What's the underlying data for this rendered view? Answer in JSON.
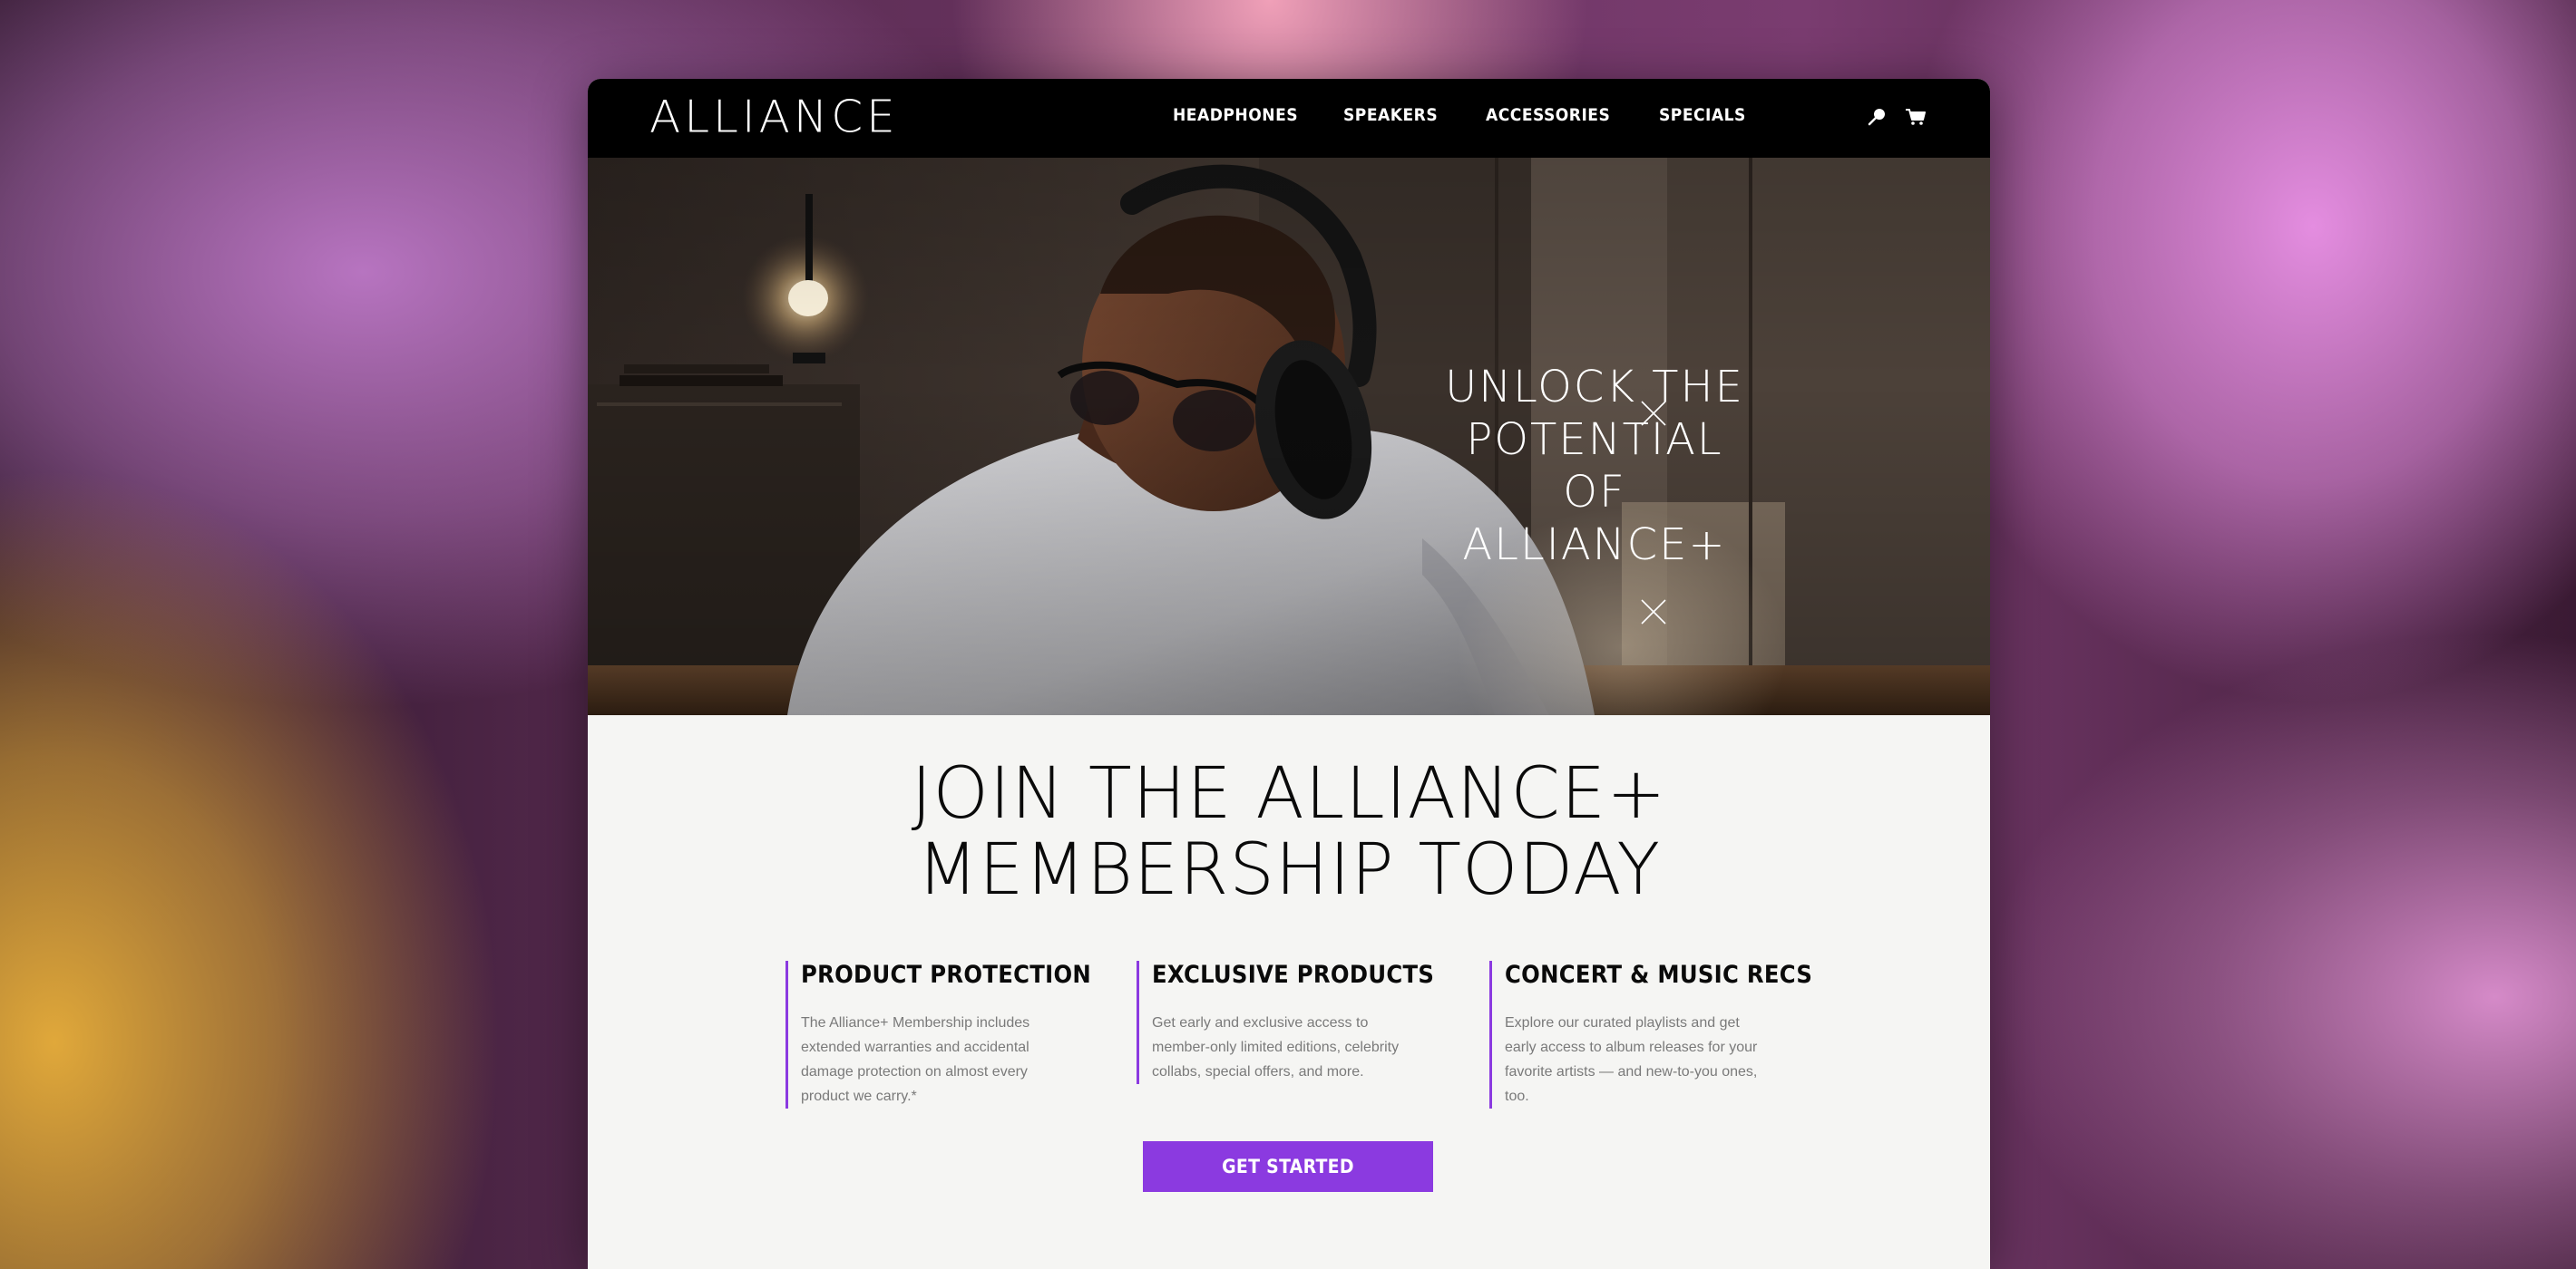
{
  "header": {
    "logo": "ALLIANCE",
    "nav": [
      {
        "label": "HEADPHONES"
      },
      {
        "label": "SPEAKERS"
      },
      {
        "label": "ACCESSORIES"
      },
      {
        "label": "SPECIALS"
      }
    ],
    "icons": [
      "search-icon",
      "cart-icon"
    ]
  },
  "hero": {
    "title_line1": "UNLOCK THE",
    "title_line2": "POTENTIAL OF",
    "title_line3": "ALLIANCE+",
    "image": "photo-man-with-headphones"
  },
  "join": {
    "line1": "JOIN THE ALLIANCE+",
    "line2": "MEMBERSHIP TODAY"
  },
  "features": [
    {
      "title": "PRODUCT PROTECTION",
      "text": "The Alliance+ Membership includes extended warranties and accidental damage protection on almost every product we carry.*"
    },
    {
      "title": "EXCLUSIVE PRODUCTS",
      "text": "Get early and exclusive access to member-only limited editions, celebrity collabs, special offers, and more."
    },
    {
      "title": "CONCERT & MUSIC RECS",
      "text": "Explore our curated playlists and get early access to album releases for your favorite artists — and new-to-you ones, too."
    }
  ],
  "cta": {
    "label": "GET STARTED"
  },
  "colors": {
    "accent": "#8b3ae0",
    "header_bg": "#000000",
    "page_bg": "#f5f5f3"
  }
}
